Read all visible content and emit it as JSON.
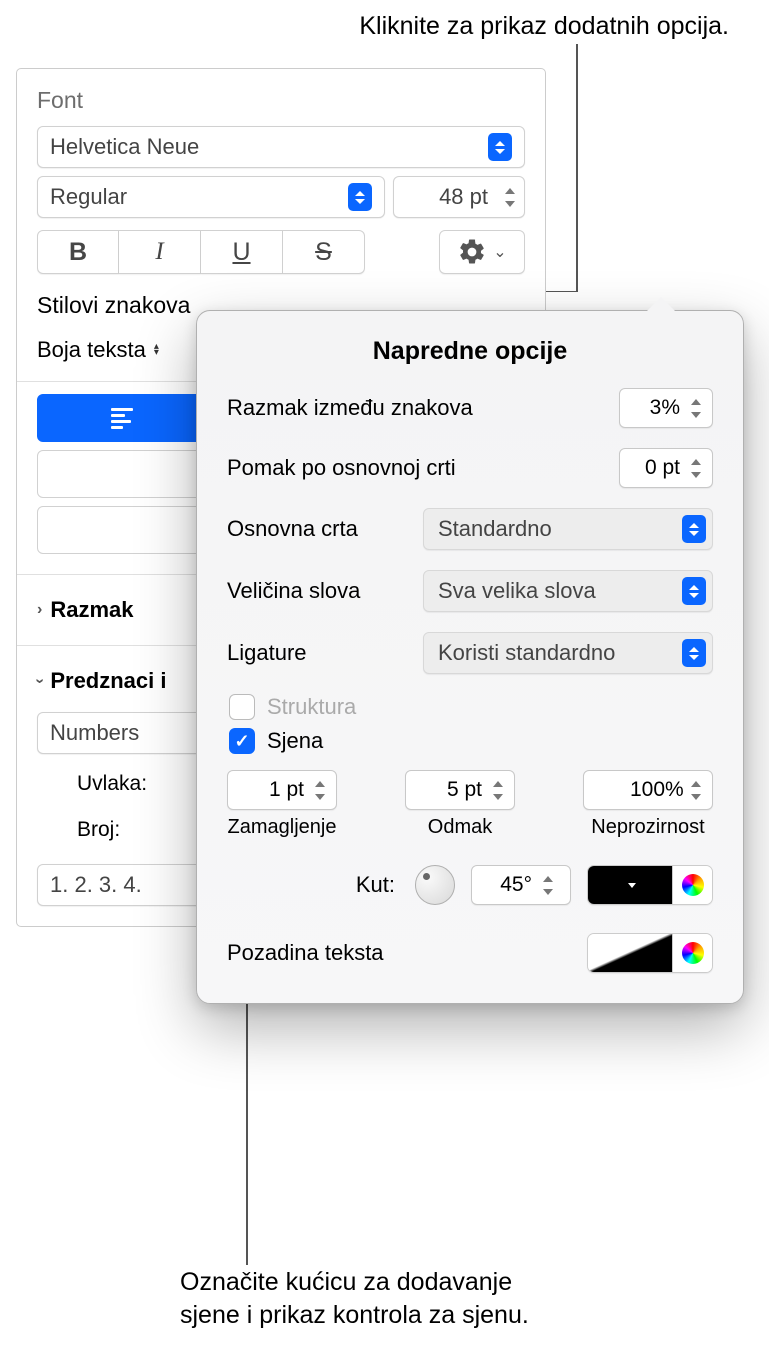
{
  "callouts": {
    "top": "Kliknite za prikaz dodatnih opcija.",
    "bottom_line1": "Označite kućicu za dodavanje",
    "bottom_line2": "sjene i prikaz kontrola za sjenu."
  },
  "panel": {
    "font_section": "Font",
    "font_family": "Helvetica Neue",
    "font_style": "Regular",
    "font_size": "48 pt",
    "character_styles": "Stilovi znakova",
    "text_color_label": "Boja teksta",
    "spacing_section": "Razmak",
    "bullets_section": "Predznaci i",
    "bullets_style": "Numbers",
    "indent_label": "Uvlaka:",
    "number_label": "Broj:",
    "list_style": "1. 2. 3. 4."
  },
  "popover": {
    "title": "Napredne opcije",
    "char_spacing_label": "Razmak između znakova",
    "char_spacing_value": "3%",
    "baseline_shift_label": "Pomak po osnovnoj crti",
    "baseline_shift_value": "0 pt",
    "baseline_label": "Osnovna crta",
    "baseline_value": "Standardno",
    "caps_label": "Veličina slova",
    "caps_value": "Sva velika slova",
    "ligatures_label": "Ligature",
    "ligatures_value": "Koristi standardno",
    "outline_label": "Struktura",
    "shadow_label": "Sjena",
    "blur_value": "1 pt",
    "blur_label": "Zamagljenje",
    "offset_value": "5 pt",
    "offset_label": "Odmak",
    "opacity_value": "100%",
    "opacity_label": "Neprozirnost",
    "angle_label": "Kut:",
    "angle_value": "45°",
    "text_bg_label": "Pozadina teksta"
  }
}
